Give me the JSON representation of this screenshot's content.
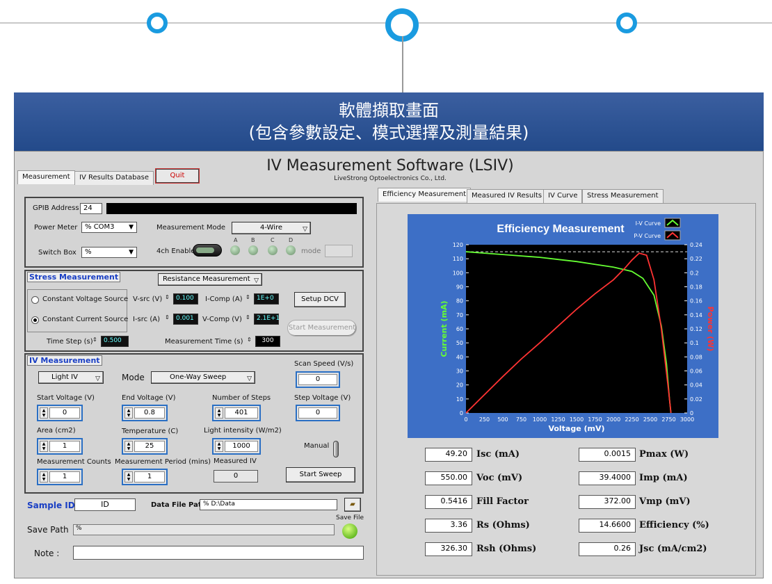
{
  "banner": {
    "line1": "軟體擷取畫面",
    "line2": "(包含參數設定、模式選擇及測量結果)"
  },
  "app": {
    "title": "IV Measurement Software (LSIV)",
    "subtitle": "LiveStrong Optoelectronics Co., Ltd."
  },
  "left_tabs": [
    "Measurement",
    "IV Results Database"
  ],
  "quit_label": "Quit",
  "right_tabs": [
    "Efficiency Measurement",
    "Measured IV Results",
    "IV Curve",
    "Stress Measurement"
  ],
  "gpib": {
    "label": "GPIB Address",
    "value": "24"
  },
  "power_meter": {
    "label": "Power Meter",
    "value": "COM3",
    "icon": "%"
  },
  "measurement_mode": {
    "label": "Measurement Mode",
    "value": "4-Wire"
  },
  "switch_box": {
    "label": "Switch Box",
    "icon": "%"
  },
  "ch_enable": {
    "label": "4ch Enable",
    "leds": [
      "A",
      "B",
      "C",
      "D"
    ],
    "mode_label": "mode"
  },
  "stress": {
    "title": "Stress Measurement",
    "type_value": "Resistance Measurement",
    "cv_label": "Constant Voltage Source",
    "cc_label": "Constant Current Source",
    "vsrc_label": "V-src (V)",
    "vsrc_value": "0.100",
    "icomp_label": "I-Comp (A)",
    "icomp_value": "1E+0",
    "isrc_label": "I-src (A)",
    "isrc_value": "0.001",
    "vcomp_label": "V-Comp (V)",
    "vcomp_value": "2.1E+1",
    "setup_dcv": "Setup DCV",
    "start_measurement": "Start Measurement",
    "time_step_label": "Time Step (s)",
    "time_step_value": "0.500",
    "meas_time_label": "Measurement Time (s)",
    "meas_time_value": "300"
  },
  "iv": {
    "title": "IV Measurement",
    "light_value": "Light IV",
    "mode_label": "Mode",
    "mode_value": "One-Way Sweep",
    "scan_speed_label": "Scan Speed (V/s)",
    "scan_speed_value": "0",
    "start_v_label": "Start Voltage (V)",
    "start_v_value": "0",
    "end_v_label": "End Voltage (V)",
    "end_v_value": "0.8",
    "steps_label": "Number of Steps",
    "steps_value": "401",
    "step_v_label": "Step Voltage (V)",
    "step_v_value": "0",
    "area_label": "Area (cm2)",
    "area_value": "1",
    "temp_label": "Temperature (C)",
    "temp_value": "25",
    "light_int_label": "Light intensity (W/m2)",
    "light_int_value": "1000",
    "manual_label": "Manual",
    "counts_label": "Measurement Counts",
    "counts_value": "1",
    "period_label": "Measurement Period (mins)",
    "period_value": "1",
    "measured_iv_label": "Measured IV",
    "measured_iv_value": "0",
    "start_sweep": "Start Sweep"
  },
  "bottom": {
    "sample_id_label": "Sample ID",
    "sample_id_value": "ID",
    "data_path_label": "Data File Path",
    "data_path_value": "D:\\Data",
    "save_file_label": "Save File",
    "save_path_label": "Save Path",
    "save_path_icon": "%",
    "note_label": "Note :"
  },
  "results": [
    {
      "value": "49.20",
      "label": "Isc (mA)"
    },
    {
      "value": "0.0015",
      "label": "Pmax (W)"
    },
    {
      "value": "550.00",
      "label": "Voc (mV)"
    },
    {
      "value": "39.4000",
      "label": "Imp (mA)"
    },
    {
      "value": "0.5416",
      "label": "Fill Factor"
    },
    {
      "value": "372.00",
      "label": "Vmp (mV)"
    },
    {
      "value": "3.36",
      "label": "Rs (Ohms)"
    },
    {
      "value": "14.6600",
      "label": "Efficiency (%)"
    },
    {
      "value": "326.30",
      "label": "Rsh (Ohms)"
    },
    {
      "value": "0.26",
      "label": "Jsc (mA/cm2)"
    }
  ],
  "colors": {
    "accent": "#1a9be0",
    "iv_curve": "#66ff33",
    "pv_curve": "#ff3333",
    "chart_frame": "#3d6fc6"
  },
  "chart_data": {
    "type": "line",
    "title": "Efficiency Measurement",
    "xlabel": "Voltage (mV)",
    "ylabel": "Current (mA)",
    "y2label": "Power (W)",
    "xlim": [
      0,
      3000
    ],
    "ylim": [
      0,
      120
    ],
    "y2lim": [
      0,
      0.24
    ],
    "xticks": [
      "0",
      "250",
      "500",
      "750",
      "1000",
      "1250",
      "1500",
      "1750",
      "2000",
      "2250",
      "2500",
      "2750",
      "3000"
    ],
    "yticks": [
      "0",
      "10",
      "20",
      "30",
      "40",
      "50",
      "60",
      "70",
      "80",
      "90",
      "100",
      "110",
      "120"
    ],
    "y2ticks": [
      "0",
      "0.02",
      "0.04",
      "0.06",
      "0.08",
      "0.1",
      "0.12",
      "0.14",
      "0.16",
      "0.18",
      "0.2",
      "0.22",
      "0.24"
    ],
    "legend": [
      "I-V Curve",
      "P-V Curve"
    ],
    "legend_position": "top-right",
    "series": [
      {
        "name": "I-V Curve",
        "axis": "left",
        "x": [
          0,
          250,
          500,
          750,
          1000,
          1250,
          1500,
          1750,
          2000,
          2250,
          2400,
          2550,
          2650,
          2720,
          2760,
          2780
        ],
        "y": [
          115,
          114,
          113,
          112,
          111,
          109.5,
          108,
          106,
          104,
          101,
          96,
          84,
          62,
          35,
          10,
          0
        ]
      },
      {
        "name": "P-V Curve",
        "axis": "right",
        "x": [
          0,
          250,
          500,
          750,
          1000,
          1250,
          1500,
          1750,
          2000,
          2150,
          2250,
          2350,
          2450,
          2550,
          2650,
          2750,
          2780
        ],
        "y": [
          0,
          0.026,
          0.052,
          0.077,
          0.1,
          0.124,
          0.148,
          0.17,
          0.19,
          0.206,
          0.218,
          0.228,
          0.225,
          0.19,
          0.12,
          0.03,
          0
        ]
      }
    ],
    "hline": {
      "axis": "left",
      "value": 115
    }
  }
}
